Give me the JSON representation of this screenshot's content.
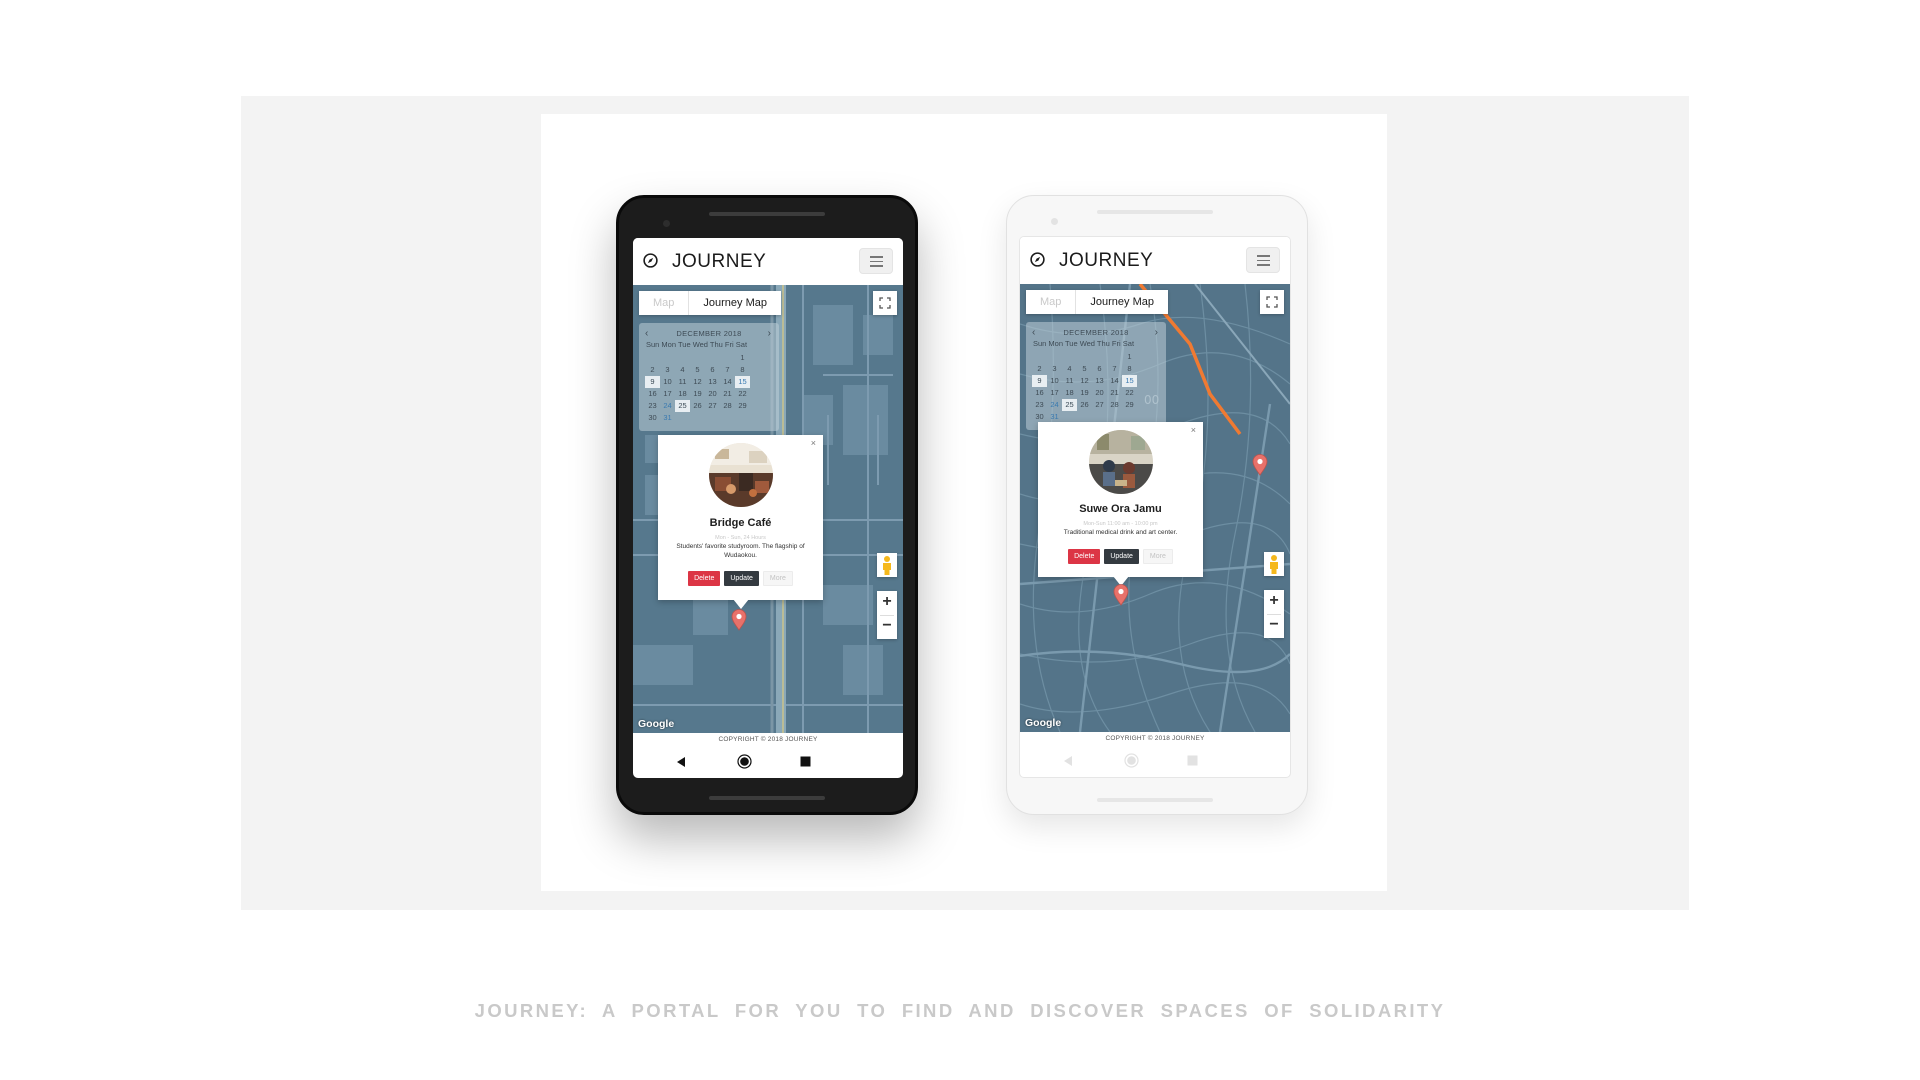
{
  "caption": "JOURNEY: A PORTAL FOR YOU TO FIND AND DISCOVER SPACES OF SOLIDARITY",
  "colors": {
    "map_water_blue": "#56788d",
    "delete": "#dc3545",
    "update": "#343a40",
    "marker": "#e8716a",
    "route_orange": "#f07a32"
  },
  "icons": {
    "brand": "compass-icon",
    "menu": "hamburger-menu-icon",
    "fullscreen": "fullscreen-icon",
    "pegman": "street-view-pegman-icon",
    "marker": "map-marker-icon",
    "back": "nav-back-triangle-icon",
    "home": "nav-home-circle-icon",
    "recent": "nav-recent-square-icon"
  },
  "phones": [
    {
      "theme": "dark",
      "app_title": "JOURNEY",
      "tabs": [
        "Map",
        "Journey Map"
      ],
      "active_tab": "Journey Map",
      "calendar": {
        "month": "DECEMBER 2018",
        "weekdays": "Sun Mon Tue Wed Thu Fri Sat",
        "rows": [
          [
            "",
            "",
            "",
            "",
            "",
            "",
            "1"
          ],
          [
            "2",
            "3",
            "4",
            "5",
            "6",
            "7",
            "8"
          ],
          [
            "9",
            "10",
            "11",
            "12",
            "13",
            "14",
            "15"
          ],
          [
            "16",
            "17",
            "18",
            "19",
            "20",
            "21",
            "22"
          ],
          [
            "23",
            "24",
            "25",
            "26",
            "27",
            "28",
            "29"
          ],
          [
            "30",
            "31",
            "",
            "",
            "",
            "",
            ""
          ]
        ],
        "selected_days": [
          "9",
          "15",
          "25"
        ],
        "highlighted_days": [
          "15",
          "24",
          "31"
        ]
      },
      "popup": {
        "close": "×",
        "name": "Bridge Café",
        "hours": "Mon - Sun, 24 Hours",
        "description": "Students' favorite studyroom. The flagship of Wudaokou.",
        "buttons": {
          "delete": "Delete",
          "update": "Update",
          "more": "More"
        }
      },
      "map_logo": "Google",
      "zoom_in": "+",
      "zoom_out": "−",
      "footer": "COPYRIGHT © 2018 JOURNEY"
    },
    {
      "theme": "light",
      "app_title": "JOURNEY",
      "tabs": [
        "Map",
        "Journey Map"
      ],
      "active_tab": "Journey Map",
      "calendar": {
        "month": "DECEMBER 2018",
        "weekdays": "Sun Mon Tue Wed Thu Fri Sat",
        "rows": [
          [
            "",
            "",
            "",
            "",
            "",
            "",
            "1"
          ],
          [
            "2",
            "3",
            "4",
            "5",
            "6",
            "7",
            "8"
          ],
          [
            "9",
            "10",
            "11",
            "12",
            "13",
            "14",
            "15"
          ],
          [
            "16",
            "17",
            "18",
            "19",
            "20",
            "21",
            "22"
          ],
          [
            "23",
            "24",
            "25",
            "26",
            "27",
            "28",
            "29"
          ],
          [
            "30",
            "31",
            "",
            "",
            "",
            "",
            ""
          ]
        ],
        "selected_days": [
          "9",
          "15",
          "25"
        ],
        "highlighted_days": [
          "15",
          "24",
          "31"
        ]
      },
      "popup": {
        "close": "×",
        "name": "Suwe Ora Jamu",
        "hours": "Mon-Sun 11:00 am - 10:00 pm",
        "description": "Traditional medical drink and art center.",
        "buttons": {
          "delete": "Delete",
          "update": "Update",
          "more": "More"
        }
      },
      "map_logo": "Google",
      "zoom_in": "+",
      "zoom_out": "−",
      "footer": "COPYRIGHT © 2018 JOURNEY"
    }
  ]
}
